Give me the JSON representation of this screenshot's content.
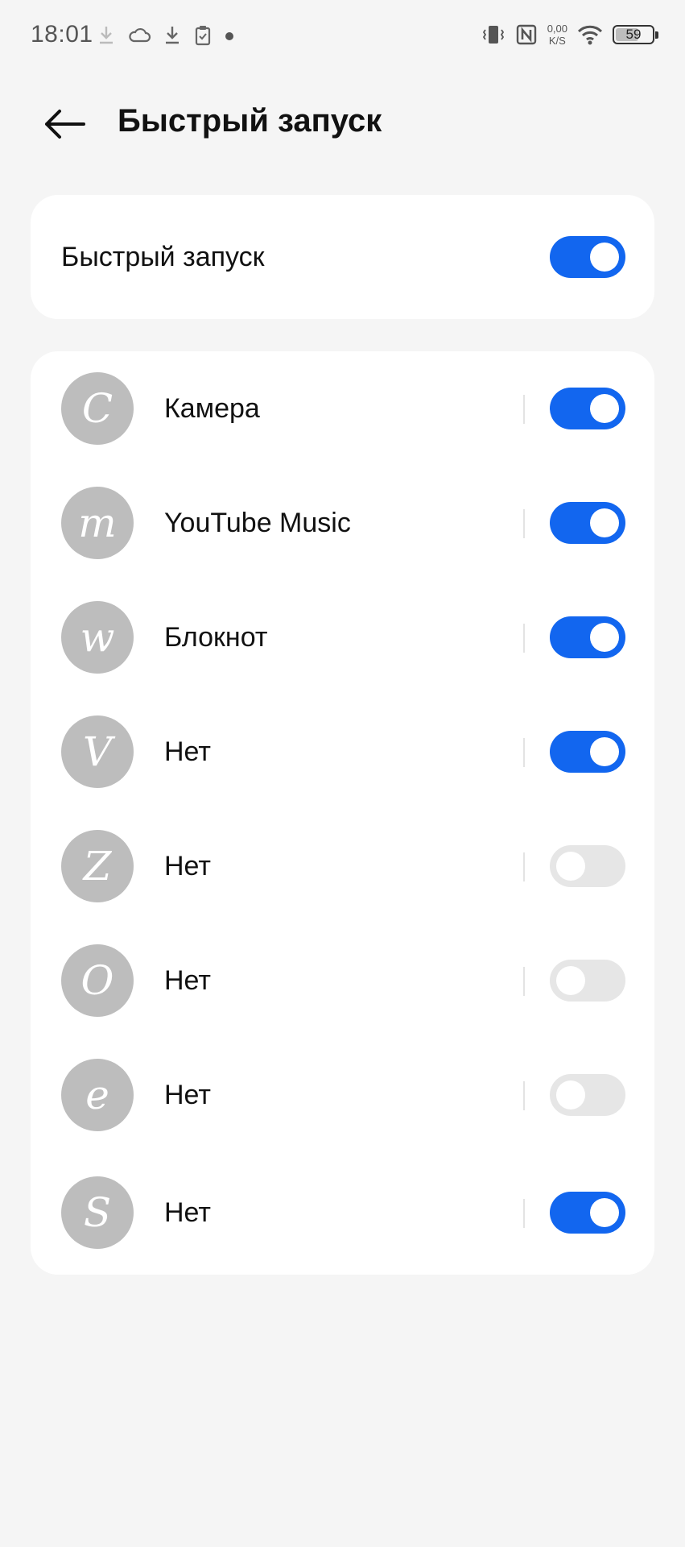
{
  "status_bar": {
    "time": "18:01",
    "net_speed_value": "0,00",
    "net_speed_unit": "K/S",
    "battery_level": "59"
  },
  "header": {
    "title": "Быстрый запуск"
  },
  "master": {
    "label": "Быстрый запуск",
    "enabled": true
  },
  "gestures": [
    {
      "letter": "C",
      "label": "Камера",
      "enabled": true
    },
    {
      "letter": "m",
      "label": "YouTube Music",
      "enabled": true
    },
    {
      "letter": "w",
      "label": "Блокнот",
      "enabled": true
    },
    {
      "letter": "V",
      "label": "Нет",
      "enabled": true
    },
    {
      "letter": "Z",
      "label": "Нет",
      "enabled": false
    },
    {
      "letter": "O",
      "label": "Нет",
      "enabled": false
    },
    {
      "letter": "e",
      "label": "Нет",
      "enabled": false
    },
    {
      "letter": "S",
      "label": "Нет",
      "enabled": true
    }
  ],
  "colors": {
    "accent": "#1266ef",
    "toggle_off": "#e6e6e6",
    "gesture_circle": "#bdbdbd",
    "background": "#f5f5f5"
  },
  "icons": [
    "download-icon",
    "cloud-icon",
    "download-icon",
    "clipboard-icon",
    "dot-icon",
    "vibrate-icon",
    "nfc-icon",
    "wifi-icon",
    "battery-icon",
    "back-arrow-icon"
  ]
}
